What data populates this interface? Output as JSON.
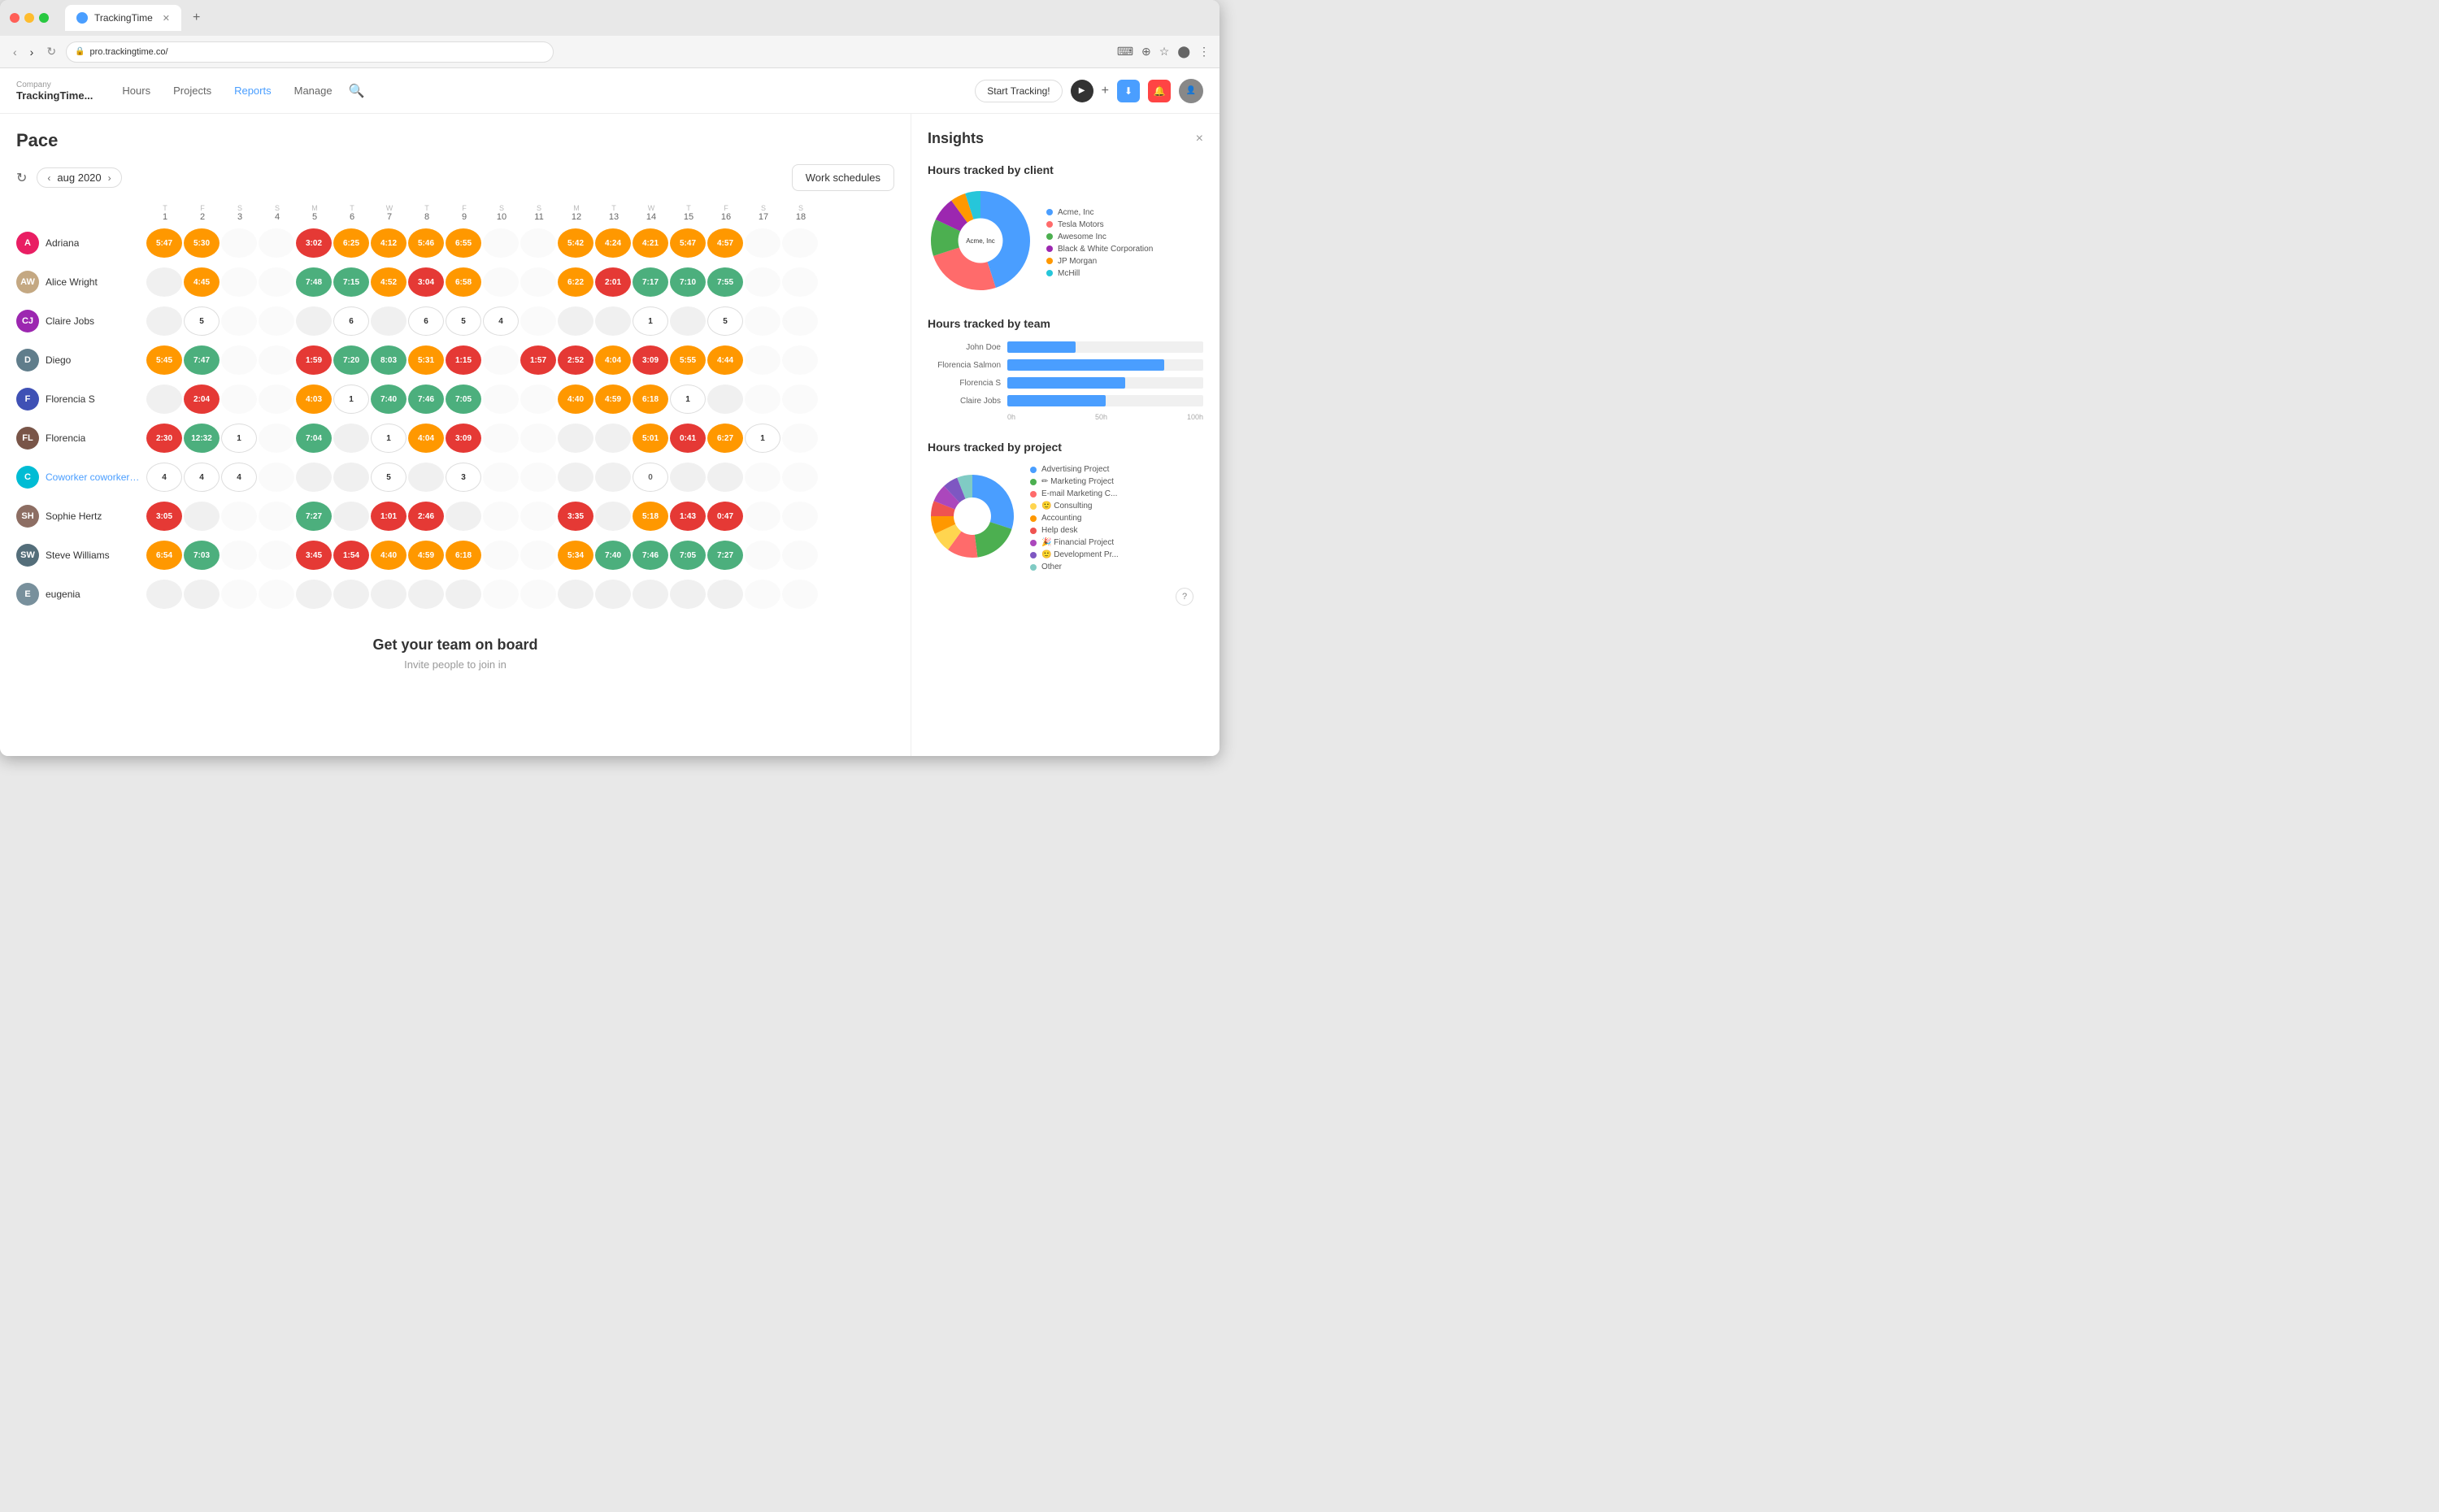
{
  "browser": {
    "url": "pro.trackingtime.co/",
    "tab_title": "TrackingTime",
    "tab_add": "+",
    "nav_back": "‹",
    "nav_forward": "›",
    "nav_refresh": "↻"
  },
  "header": {
    "company_label": "Company",
    "company_name": "TrackingTime...",
    "nav_hours": "Hours",
    "nav_projects": "Projects",
    "nav_reports": "Reports",
    "nav_manage": "Manage",
    "start_tracking": "Start Tracking!",
    "plus_btn": "+"
  },
  "pace": {
    "title": "Pace",
    "month": "aug 2020",
    "work_schedules_btn": "Work schedules"
  },
  "grid": {
    "days": [
      {
        "letter": "T",
        "num": "1"
      },
      {
        "letter": "F",
        "num": "2"
      },
      {
        "letter": "S",
        "num": "3"
      },
      {
        "letter": "S",
        "num": "4"
      },
      {
        "letter": "M",
        "num": "5"
      },
      {
        "letter": "T",
        "num": "6"
      },
      {
        "letter": "W",
        "num": "7"
      },
      {
        "letter": "T",
        "num": "8"
      },
      {
        "letter": "F",
        "num": "9"
      },
      {
        "letter": "S",
        "num": "10"
      },
      {
        "letter": "S",
        "num": "11"
      },
      {
        "letter": "M",
        "num": "12"
      },
      {
        "letter": "T",
        "num": "13"
      },
      {
        "letter": "W",
        "num": "14"
      },
      {
        "letter": "T",
        "num": "15"
      },
      {
        "letter": "F",
        "num": "16"
      },
      {
        "letter": "S",
        "num": "17"
      },
      {
        "letter": "S",
        "num": "18"
      }
    ],
    "people": [
      {
        "name": "Adriana",
        "avatar_color": "#e91e63",
        "avatar_letter": "A",
        "cells": [
          "5:47",
          "5:30",
          "",
          "",
          "3:02",
          "6:25",
          "4:12",
          "5:46",
          "6:55",
          "",
          "",
          "5:42",
          "4:24",
          "4:21",
          "5:47",
          "4:57",
          "",
          ""
        ]
      },
      {
        "name": "Alice Wright",
        "avatar_color": "#ffb74d",
        "avatar_letter": "AW",
        "cells": [
          "",
          "4:45",
          "",
          "",
          "7:48",
          "7:15",
          "4:52",
          "3:04",
          "6:58",
          "",
          "",
          "6:22",
          "2:01",
          "7:17",
          "7:10",
          "7:55",
          "",
          ""
        ]
      },
      {
        "name": "Claire Jobs",
        "avatar_color": "#9c27b0",
        "avatar_letter": "CJ",
        "cells": [
          "",
          "5",
          "",
          "",
          "",
          "6",
          "",
          "6",
          "5",
          "4",
          "",
          "",
          "",
          "1",
          "",
          "5",
          "",
          ""
        ]
      },
      {
        "name": "Diego",
        "avatar_color": "#607d8b",
        "avatar_letter": "D",
        "cells": [
          "5:45",
          "7:47",
          "",
          "",
          "1:59",
          "7:20",
          "8:03",
          "5:31",
          "1:15",
          "",
          "1:57",
          "2:52",
          "4:04",
          "3:09",
          "5:55",
          "4:44",
          "",
          ""
        ]
      },
      {
        "name": "Florencia S",
        "avatar_color": "#3f51b5",
        "avatar_letter": "F",
        "cells": [
          "",
          "2:04",
          "",
          "",
          "4:03",
          "1",
          "7:40",
          "7:46",
          "7:05",
          "",
          "",
          "4:40",
          "4:59",
          "6:18",
          "1",
          "",
          "",
          ""
        ]
      },
      {
        "name": "Florencia",
        "avatar_color": "#795548",
        "avatar_letter": "FL",
        "cells": [
          "2:30",
          "12:32",
          "1",
          "",
          "7:04",
          "",
          "1",
          "4:04",
          "3:09",
          "",
          "",
          "",
          "",
          "5:01",
          "0:41",
          "6:27",
          "1",
          ""
        ]
      },
      {
        "name": "Coworker coworker@trac...",
        "avatar_color": "#00bcd4",
        "avatar_letter": "C",
        "is_coworker": true,
        "cells": [
          "4",
          "4",
          "4",
          "",
          "",
          "",
          "5",
          "",
          "3",
          "",
          "",
          "",
          "",
          "0",
          "",
          "",
          "",
          ""
        ]
      },
      {
        "name": "Sophie Hertz",
        "avatar_color": "#8d6e63",
        "avatar_letter": "SH",
        "cells": [
          "3:05",
          "",
          "",
          "",
          "7:27",
          "",
          "1:01",
          "2:46",
          "",
          "",
          "",
          "3:35",
          "",
          "5:18",
          "1:43",
          "0:47",
          "",
          ""
        ]
      },
      {
        "name": "Steve Williams",
        "avatar_color": "#546e7a",
        "avatar_letter": "SW",
        "cells": [
          "6:54",
          "7:03",
          "",
          "",
          "3:45",
          "1:54",
          "4:40",
          "4:59",
          "6:18",
          "",
          "",
          "5:34",
          "7:40",
          "7:46",
          "7:05",
          "7:27",
          "",
          ""
        ]
      },
      {
        "name": "eugenia",
        "avatar_color": "#78909c",
        "avatar_letter": "E",
        "cells": [
          "",
          "",
          "",
          "",
          "",
          "",
          "",
          "",
          "",
          "",
          "",
          "",
          "",
          "",
          "",
          "",
          "",
          ""
        ]
      }
    ]
  },
  "get_team": {
    "title": "Get your team on board",
    "subtitle": "Invite people to join in"
  },
  "insights": {
    "title": "Insights",
    "close_btn": "×",
    "sections": [
      {
        "title": "Hours tracked by client",
        "legend": [
          {
            "label": "Acme, Inc",
            "color": "#4a9eff"
          },
          {
            "label": "Tesla Motors",
            "color": "#ff6b6b"
          },
          {
            "label": "Awesome Inc",
            "color": "#4caf50"
          },
          {
            "label": "Black & White Corporation",
            "color": "#9c27b0"
          },
          {
            "label": "JP Morgan",
            "color": "#ff9800"
          },
          {
            "label": "McHill",
            "color": "#26c6da"
          }
        ],
        "pie_data": [
          {
            "value": 45,
            "color": "#4a9eff",
            "label": "Acme, Inc"
          },
          {
            "value": 25,
            "color": "#ff6b6b",
            "label": "Tesla Motors"
          },
          {
            "value": 12,
            "color": "#4caf50",
            "label": "Awesome Inc"
          },
          {
            "value": 8,
            "color": "#9c27b0",
            "label": "Black & White"
          },
          {
            "value": 5,
            "color": "#ff9800",
            "label": "JP Morgan"
          },
          {
            "value": 5,
            "color": "#26c6da",
            "label": "McHill"
          }
        ]
      },
      {
        "title": "Hours tracked by team",
        "bars": [
          {
            "label": "John Doe",
            "value": 35,
            "max": 100
          },
          {
            "label": "Florencia Salmon",
            "value": 80,
            "max": 100
          },
          {
            "label": "Florencia S",
            "value": 60,
            "max": 100
          },
          {
            "label": "Claire Jobs",
            "value": 50,
            "max": 100
          }
        ],
        "axis": [
          "0h",
          "50h",
          "100h"
        ]
      },
      {
        "title": "Hours tracked by project",
        "legend": [
          {
            "label": "Advertising Project",
            "color": "#4a9eff"
          },
          {
            "label": "✏ Marketing Project",
            "color": "#4caf50"
          },
          {
            "label": "E-mail Marketing C...",
            "color": "#ff6b6b"
          },
          {
            "label": "🙂 Consulting",
            "color": "#ffd54f"
          },
          {
            "label": "Accounting",
            "color": "#ff9800"
          },
          {
            "label": "Help desk",
            "color": "#ef5350"
          },
          {
            "label": "🎉 Financial Project",
            "color": "#ab47bc"
          },
          {
            "label": "🙂 Development Pr...",
            "color": "#7e57c2"
          },
          {
            "label": "Other",
            "color": "#80cbc4"
          }
        ],
        "pie_data": [
          {
            "value": 30,
            "color": "#4a9eff"
          },
          {
            "value": 18,
            "color": "#4caf50"
          },
          {
            "value": 12,
            "color": "#ff6b6b"
          },
          {
            "value": 8,
            "color": "#ffd54f"
          },
          {
            "value": 7,
            "color": "#ff9800"
          },
          {
            "value": 6,
            "color": "#ef5350"
          },
          {
            "value": 7,
            "color": "#ab47bc"
          },
          {
            "value": 6,
            "color": "#7e57c2"
          },
          {
            "value": 6,
            "color": "#80cbc4"
          }
        ]
      }
    ]
  }
}
